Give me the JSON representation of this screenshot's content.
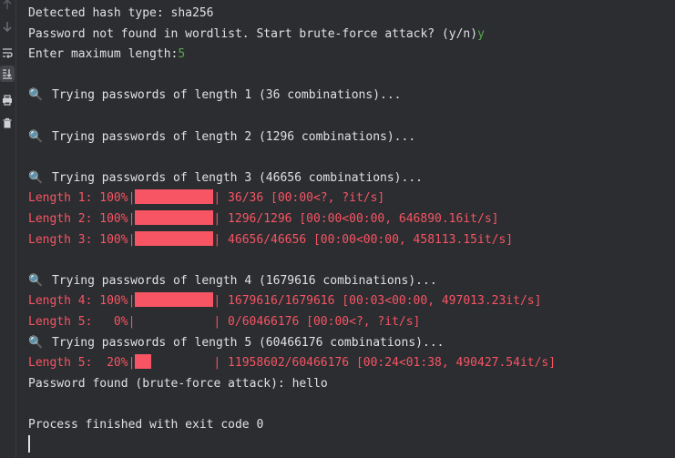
{
  "gutter": {
    "icons": [
      "arrow-up-icon",
      "arrow-down-icon",
      "soft-wrap-icon",
      "scroll-to-end-icon",
      "print-icon",
      "trash-icon"
    ]
  },
  "colors": {
    "background": "#2b2d30",
    "text": "#dfe1e5",
    "stderr": "#f75464",
    "user_input": "#57a64a"
  },
  "output": {
    "l1": "Detected hash type: sha256",
    "l2_text": "Password not found in wordlist. Start brute-force attack? (y/n)",
    "l2_input": "y",
    "l3_text": "Enter maximum length:",
    "l3_input": "5",
    "search_emoji": "🔍",
    "try1": "Trying passwords of length 1 (36 combinations)...",
    "try2": "Trying passwords of length 2 (1296 combinations)...",
    "try3": "Trying passwords of length 3 (46656 combinations)...",
    "try4": "Trying passwords of length 4 (1679616 combinations)...",
    "try5": "Trying passwords of length 5 (60466176 combinations)...",
    "progress": [
      {
        "prefix": "Length 1: 100%|",
        "fill": 1.0,
        "suffix": "| 36/36 [00:00<?, ?it/s]"
      },
      {
        "prefix": "Length 2: 100%|",
        "fill": 1.0,
        "suffix": "| 1296/1296 [00:00<00:00, 646890.16it/s]"
      },
      {
        "prefix": "Length 3: 100%|",
        "fill": 1.0,
        "suffix": "| 46656/46656 [00:00<00:00, 458113.15it/s]"
      },
      {
        "prefix": "Length 4: 100%|",
        "fill": 1.0,
        "suffix": "| 1679616/1679616 [00:03<00:00, 497013.23it/s]"
      },
      {
        "prefix": "Length 5:   0%|",
        "fill": 0.0,
        "suffix": "| 0/60466176 [00:00<?, ?it/s]"
      },
      {
        "prefix": "Length 5:  20%|",
        "fill": 0.2,
        "suffix": "| 11958602/60466176 [00:24<01:38, 490427.54it/s]"
      }
    ],
    "found": "Password found (brute-force attack): hello",
    "exit": "Process finished with exit code 0"
  }
}
